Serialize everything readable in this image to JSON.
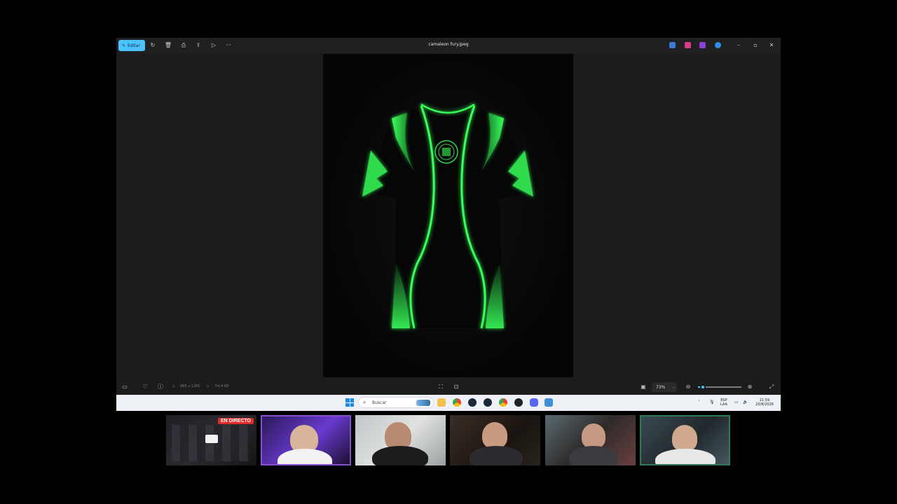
{
  "window": {
    "title": "camaleon fury.jpeg",
    "edit_label": "Editar"
  },
  "status": {
    "dimensions": "968 x 1260",
    "file_size": "54.4 KB",
    "zoom": "73%",
    "zoom_level": 0.12
  },
  "taskbar": {
    "search_placeholder": "Buscar",
    "lang_line1": "ESP",
    "lang_line2": "LAA",
    "time": "21:59",
    "date": "20/8/2026"
  },
  "stream": {
    "live_label": "EN DIRECTO"
  },
  "colors": {
    "accent": "#4cc2ff",
    "jersey_green": "#39ff5a",
    "live_red": "#e02b2b"
  }
}
